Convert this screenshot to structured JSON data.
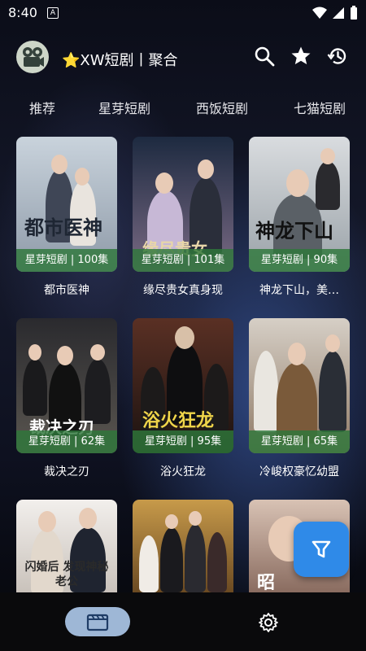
{
  "status": {
    "time": "8:40",
    "notif_letter": "A"
  },
  "header": {
    "title": "⭐XW短剧丨聚合"
  },
  "tabs": [
    "推荐",
    "星芽短剧",
    "西饭短剧",
    "七猫短剧"
  ],
  "cards": [
    {
      "title": "都市医神",
      "badge": "星芽短剧 | 100集",
      "poster_text": "都市医神",
      "poster_colors": [
        "#c9d3dc",
        "#8e9aa8"
      ]
    },
    {
      "title": "缘尽贵女真身现",
      "badge": "星芽短剧 | 101集",
      "poster_text": "缘尽贵女",
      "poster_colors": [
        "#1d2a40",
        "#7a6a84"
      ]
    },
    {
      "title": "神龙下山，美…",
      "badge": "星芽短剧 | 90集",
      "poster_text": "神龙下山",
      "poster_colors": [
        "#d9dcdf",
        "#9aa2a8"
      ]
    },
    {
      "title": "裁决之刃",
      "badge": "星芽短剧 | 62集",
      "poster_text": "裁决之刃",
      "poster_colors": [
        "#2a2a2e",
        "#5a5650"
      ]
    },
    {
      "title": "浴火狂龙",
      "badge": "星芽短剧 | 95集",
      "poster_text": "浴火狂龙",
      "poster_colors": [
        "#5a3024",
        "#1a1210"
      ]
    },
    {
      "title": "冷峻权豪忆幼盟",
      "badge": "星芽短剧 | 65集",
      "poster_text": "",
      "poster_colors": [
        "#d6cfc6",
        "#8f7a66"
      ]
    },
    {
      "title": "",
      "badge": "",
      "poster_text": "闪婚后 发现神秘老公",
      "poster_colors": [
        "#f2efec",
        "#c9c2bb"
      ]
    },
    {
      "title": "",
      "badge": "",
      "poster_text": "",
      "poster_colors": [
        "#c79a4a",
        "#6b4a22"
      ]
    },
    {
      "title": "",
      "badge": "",
      "poster_text": "昭",
      "poster_colors": [
        "#d8c2b4",
        "#8a6c60"
      ]
    }
  ],
  "icons": {
    "search": "search-icon",
    "favorite": "star-icon",
    "history": "history-icon",
    "filter": "filter-icon",
    "home_tab": "film-icon",
    "settings_tab": "gear-icon"
  },
  "colors": {
    "accent": "#2f8ae8",
    "badge": "#2e783a",
    "nav_active": "#9eb7d6"
  }
}
